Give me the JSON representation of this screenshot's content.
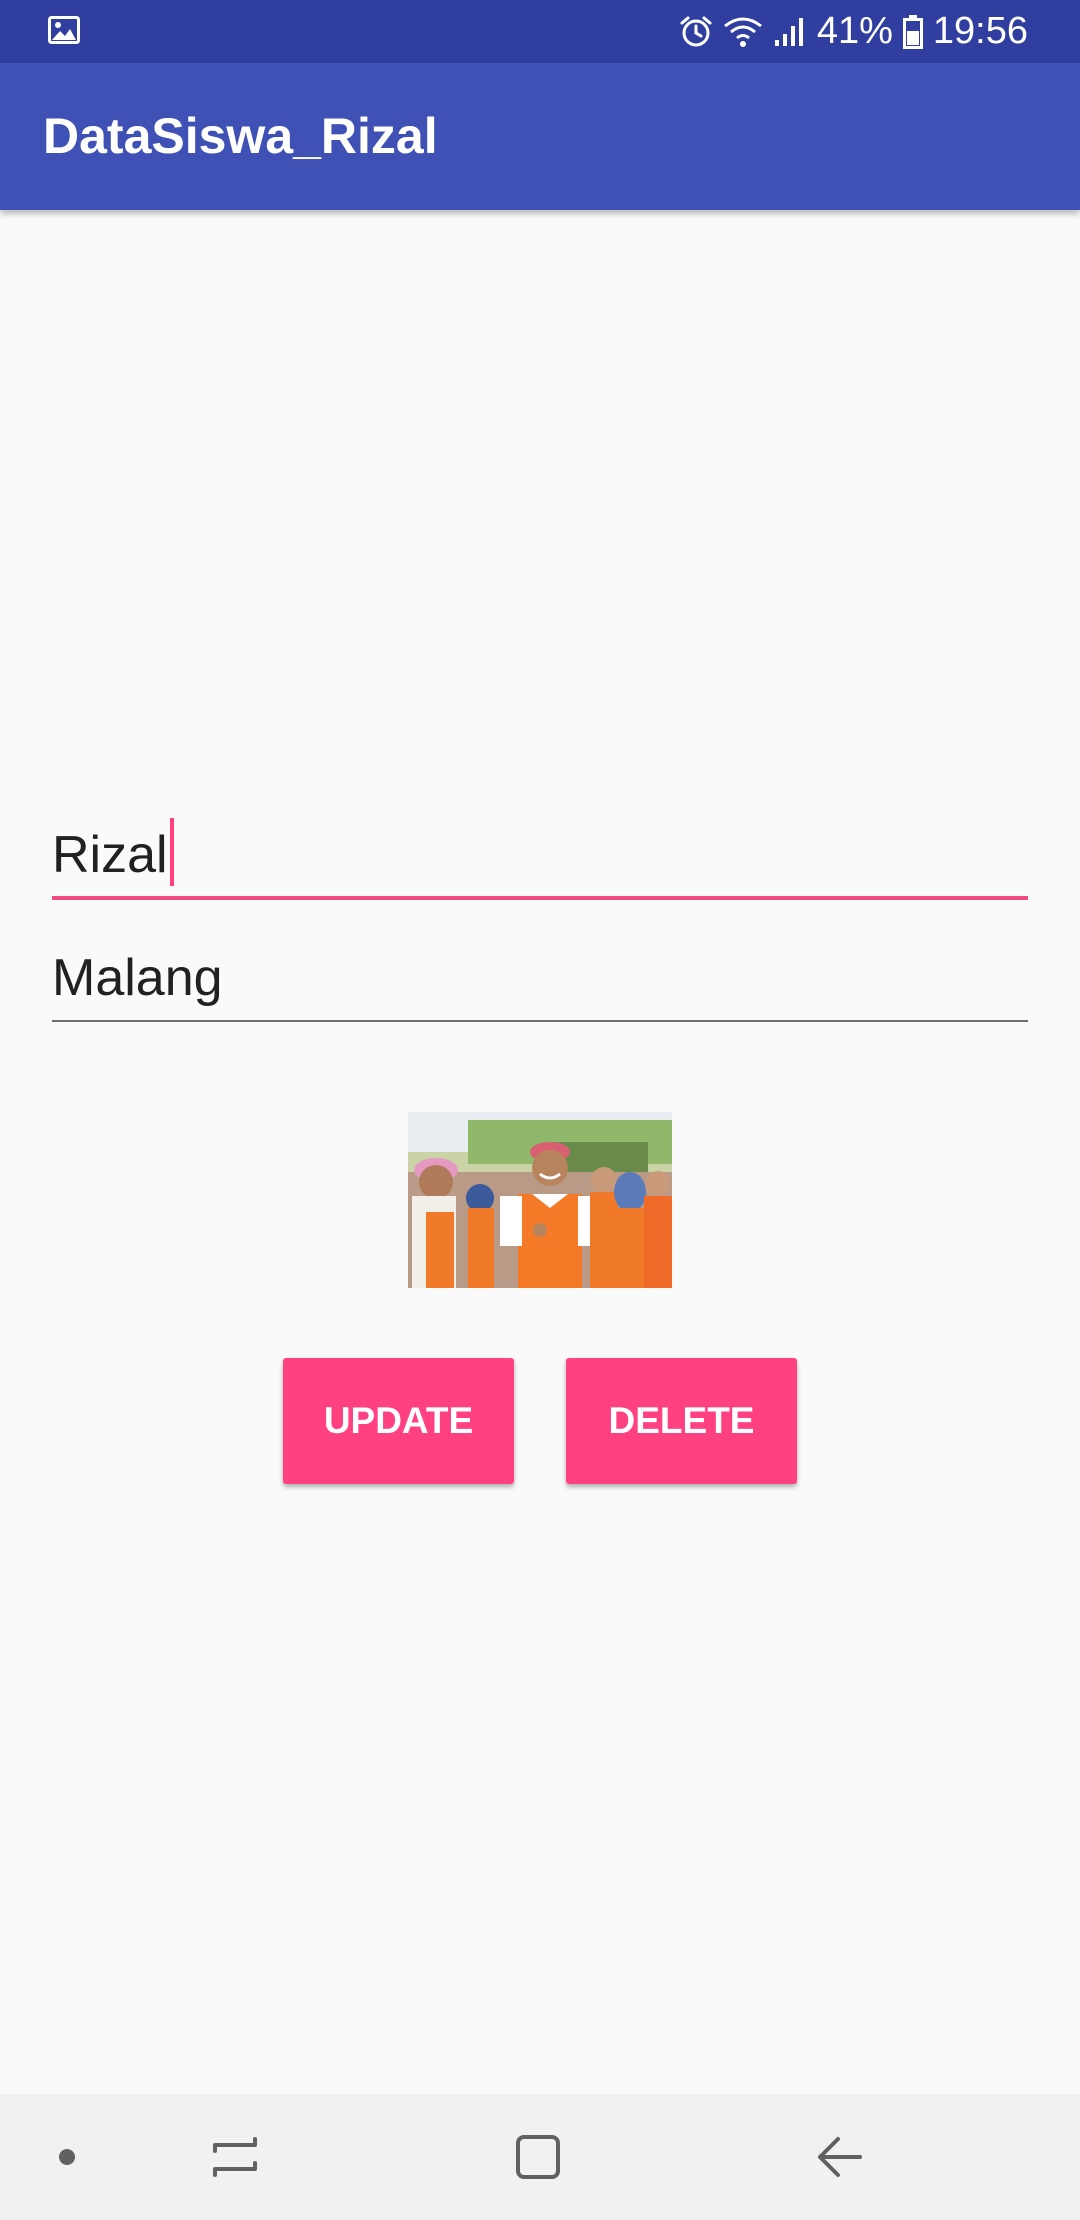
{
  "status_bar": {
    "left_icon": "gallery-notification-icon",
    "alarm_icon": "alarm-icon",
    "wifi_icon": "wifi-icon",
    "signal_icon": "cellular-signal-icon",
    "battery_percent": "41%",
    "battery_icon": "battery-icon",
    "time": "19:56"
  },
  "app_bar": {
    "title": "DataSiswa_Rizal"
  },
  "form": {
    "name_value": "Rizal",
    "city_value": "Malang"
  },
  "photo": {
    "alt": "student-photo"
  },
  "actions": {
    "update_label": "UPDATE",
    "delete_label": "DELETE"
  },
  "nav_bar": {
    "items": [
      "dot-icon",
      "recent-apps-icon",
      "home-icon",
      "back-icon"
    ]
  },
  "colors": {
    "status_bar": "#303f9f",
    "app_bar": "#3f51b5",
    "accent": "#ff4081",
    "background": "#fafafa"
  }
}
